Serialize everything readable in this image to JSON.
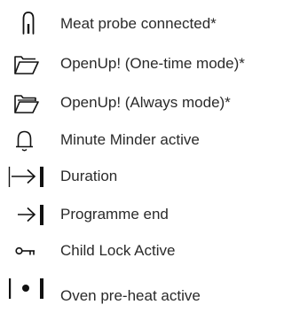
{
  "legend": {
    "items": [
      {
        "icon": "meat-probe-icon",
        "label": "Meat probe connected*"
      },
      {
        "icon": "oven-door-outline-icon",
        "label": "OpenUp! (One-time mode)*"
      },
      {
        "icon": "oven-door-filled-icon",
        "label": "OpenUp! (Always mode)*"
      },
      {
        "icon": "bell-icon",
        "label": "Minute Minder active"
      },
      {
        "icon": "bracket-arrow-icon",
        "label": "Duration"
      },
      {
        "icon": "arrow-bar-icon",
        "label": "Programme end"
      },
      {
        "icon": "key-icon",
        "label": "Child Lock Active"
      },
      {
        "icon": "dot-bars-icon",
        "label": "Oven pre-heat active"
      }
    ]
  }
}
